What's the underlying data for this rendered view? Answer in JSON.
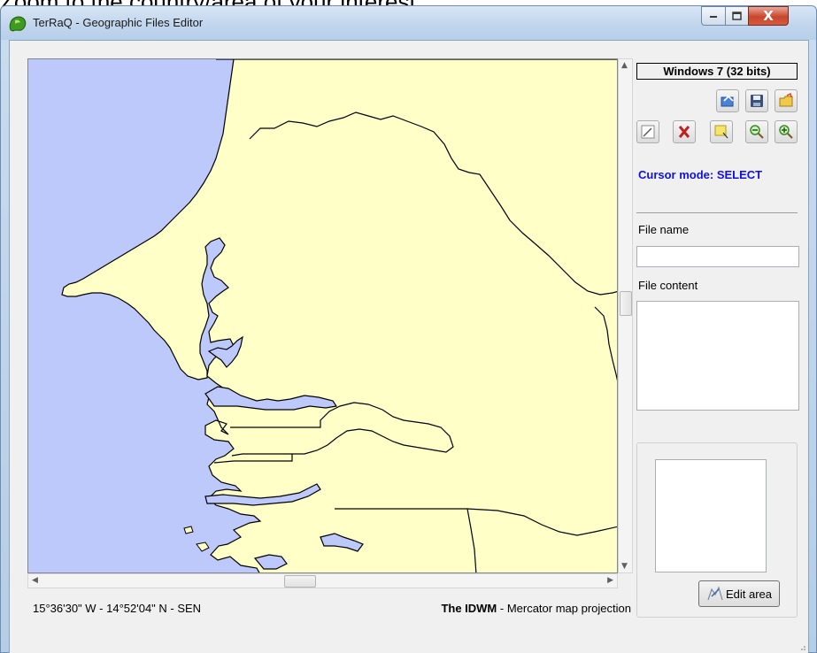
{
  "caption": {
    "text": "Zoom to the country/area of your interest."
  },
  "window": {
    "title": "TerRaQ - Geographic Files Editor",
    "controls": {
      "minimize_icon": "minimize-icon",
      "maximize_icon": "maximize-icon",
      "close_glyph": "X"
    }
  },
  "colors": {
    "ocean": "#bdc8fb",
    "land": "#ffffc8",
    "border": "#000000",
    "cursor_mode_text": "#1010e8"
  },
  "status": {
    "coordinates": "15°36'30\" W - 14°52'04\" N - SEN",
    "projection_bold": "The IDWM",
    "projection_rest": " - Mercator map projection"
  },
  "side": {
    "os_badge": "Windows 7 (32 bits)",
    "toolbar_row1": [
      "open-file-icon",
      "save-icon",
      "open-folder-icon"
    ],
    "toolbar_row2": [
      "edit-icon",
      "delete-icon",
      "select-rect-icon",
      "zoom-out-icon",
      "zoom-in-icon"
    ],
    "cursor_mode": "Cursor mode: SELECT",
    "file_name_label": "File name",
    "file_name_value": "",
    "file_content_label": "File content",
    "file_content_value": "",
    "edit_area_label": "Edit area"
  }
}
